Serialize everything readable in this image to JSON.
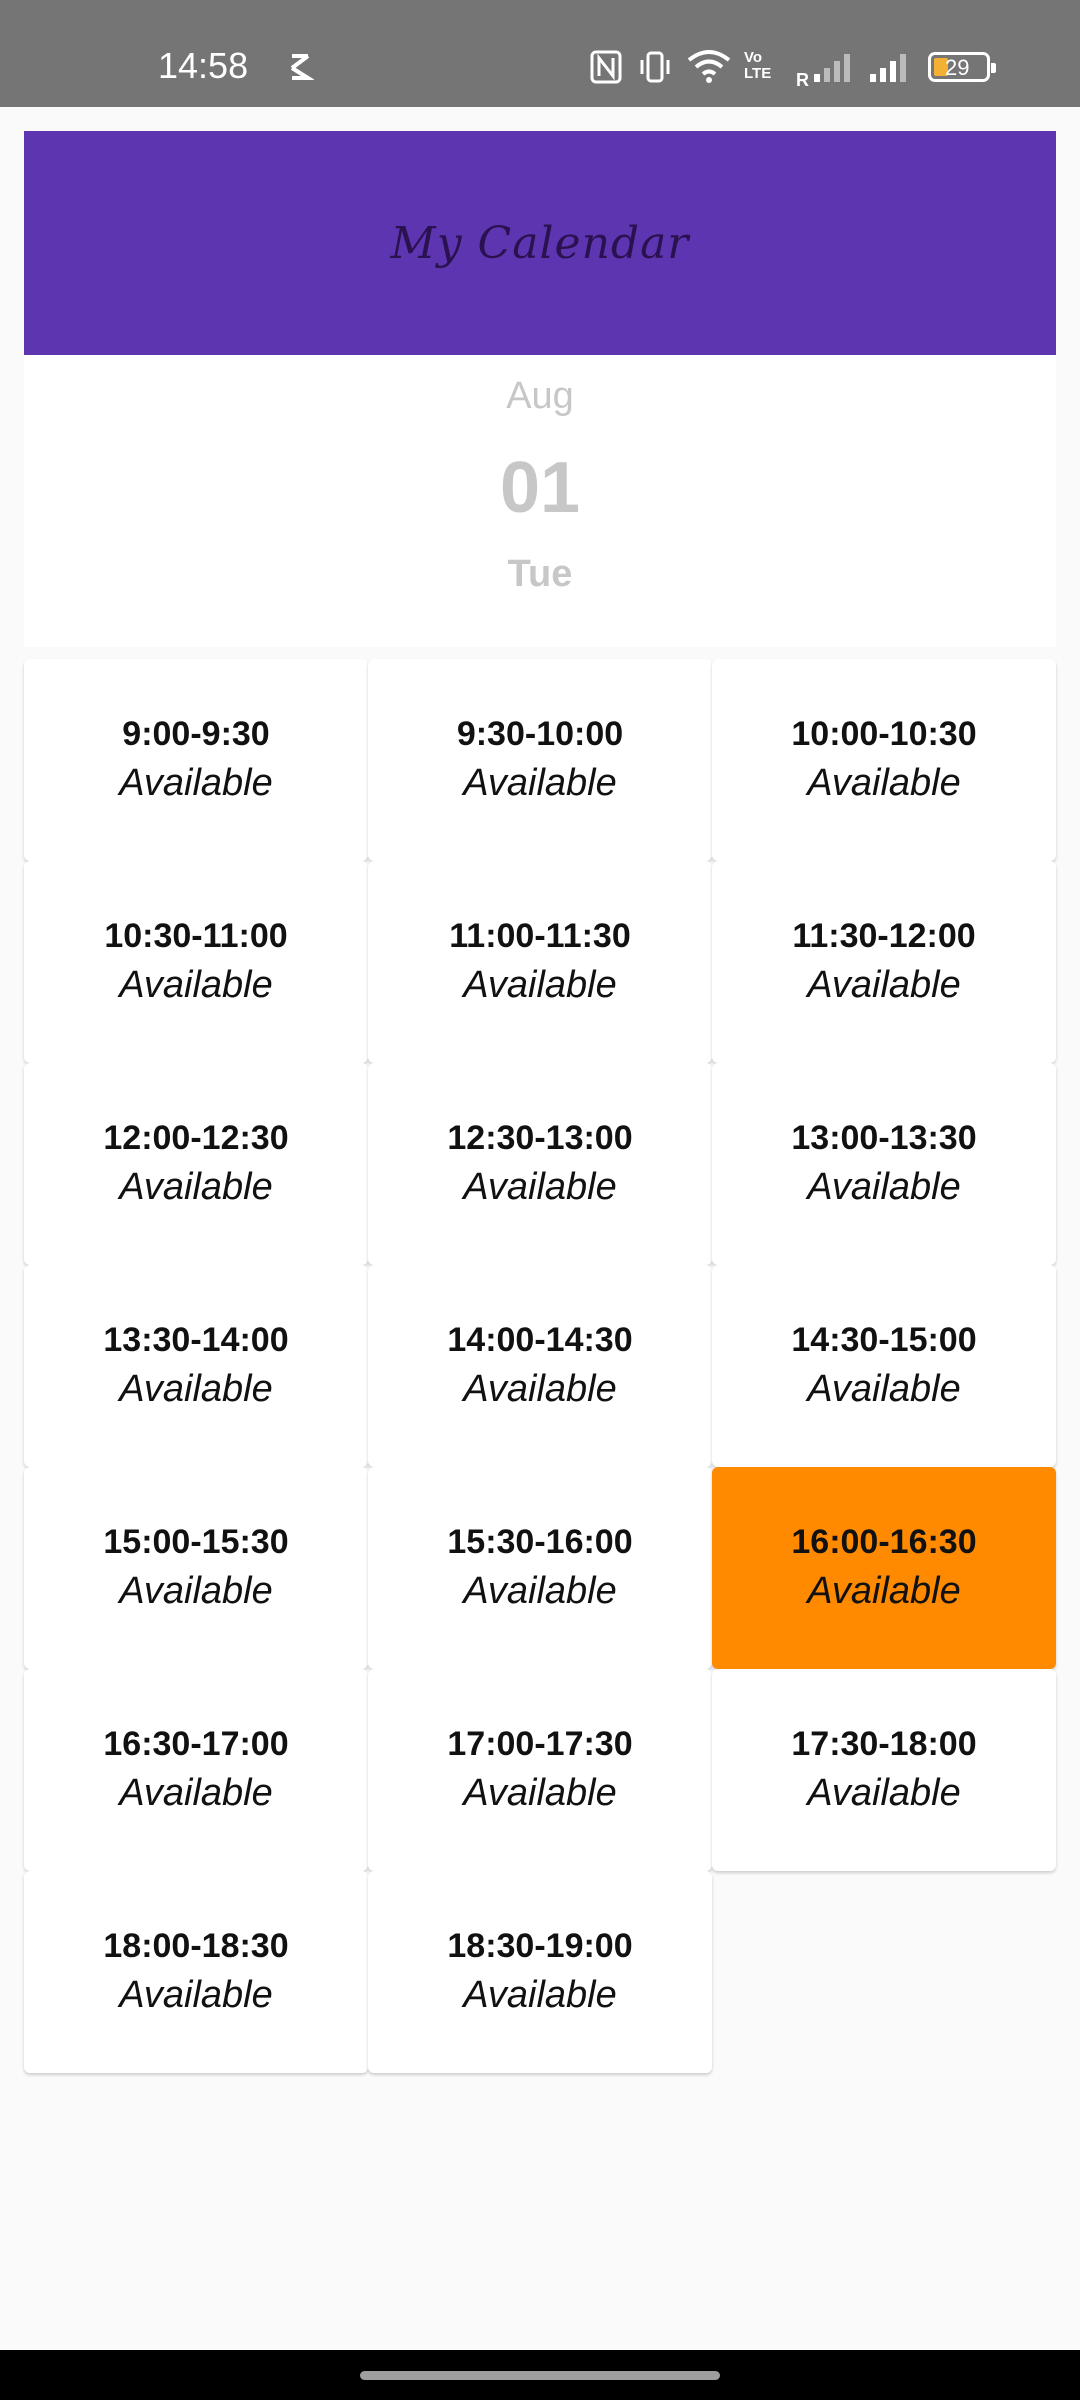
{
  "status_bar": {
    "time": "14:58",
    "battery_level": "29",
    "icons": [
      "s-app-icon",
      "nfc-icon",
      "vibrate-icon",
      "wifi-icon",
      "volte-icon",
      "signal-roaming-icon",
      "signal-icon",
      "battery-icon"
    ],
    "roaming_label": "R",
    "volte_label": "Vo LTE"
  },
  "header": {
    "title": "My Calendar",
    "color": "#5e35b1"
  },
  "date": {
    "month": "Aug",
    "day": "01",
    "weekday": "Tue"
  },
  "slots": [
    {
      "range": "9:00-9:30",
      "status": "Available"
    },
    {
      "range": "9:30-10:00",
      "status": "Available"
    },
    {
      "range": "10:00-10:30",
      "status": "Available"
    },
    {
      "range": "10:30-11:00",
      "status": "Available"
    },
    {
      "range": "11:00-11:30",
      "status": "Available"
    },
    {
      "range": "11:30-12:00",
      "status": "Available"
    },
    {
      "range": "12:00-12:30",
      "status": "Available"
    },
    {
      "range": "12:30-13:00",
      "status": "Available"
    },
    {
      "range": "13:00-13:30",
      "status": "Available"
    },
    {
      "range": "13:30-14:00",
      "status": "Available"
    },
    {
      "range": "14:00-14:30",
      "status": "Available"
    },
    {
      "range": "14:30-15:00",
      "status": "Available"
    },
    {
      "range": "15:00-15:30",
      "status": "Available"
    },
    {
      "range": "15:30-16:00",
      "status": "Available"
    },
    {
      "range": "16:00-16:30",
      "status": "Available",
      "selected": true
    },
    {
      "range": "16:30-17:00",
      "status": "Available"
    },
    {
      "range": "17:00-17:30",
      "status": "Available"
    },
    {
      "range": "17:30-18:00",
      "status": "Available"
    },
    {
      "range": "18:00-18:30",
      "status": "Available"
    },
    {
      "range": "18:30-19:00",
      "status": "Available"
    }
  ],
  "colors": {
    "selected": "#ff8a00",
    "date_text": "#c7c7c7"
  }
}
